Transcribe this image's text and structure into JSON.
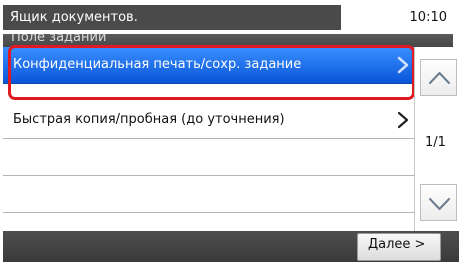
{
  "header": {
    "title": "Ящик документов.",
    "time": "10:10",
    "section_title": "Поле заданий"
  },
  "list": {
    "items": [
      {
        "label": "Конфиденциальная печать/сохр. задание",
        "selected": true,
        "icon": "chevron-right-icon"
      },
      {
        "label": "Быстрая копия/пробная (до уточнения)",
        "selected": false,
        "icon": "chevron-right-icon"
      },
      {
        "label": ""
      },
      {
        "label": ""
      },
      {
        "label": ""
      }
    ]
  },
  "scroll": {
    "page_indicator": "1/1",
    "up_icon": "chevron-up-icon",
    "down_icon": "chevron-down-icon"
  },
  "footer": {
    "next_label": "Далее >",
    "enter_icon": "enter-icon"
  },
  "colors": {
    "selection": "#1565e8",
    "highlight_border": "#e11a22",
    "header_bg": "#4a4a4a"
  }
}
